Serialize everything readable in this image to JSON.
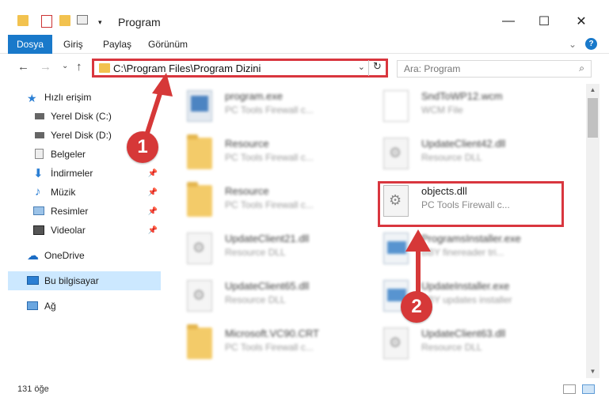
{
  "window": {
    "title": "Program",
    "minimize": "—",
    "maximize": "☐",
    "close": "✕"
  },
  "ribbon": {
    "tabs": [
      "Dosya",
      "Giriş",
      "Paylaş",
      "Görünüm"
    ],
    "expand_icon": "⌄",
    "help_icon": "?"
  },
  "nav": {
    "back": "←",
    "forward": "→",
    "recent": "⌄",
    "up": "↑"
  },
  "address": {
    "path": "C:\\Program Files\\Program Dizini",
    "dropdown": "⌄",
    "refresh": "↻"
  },
  "search": {
    "placeholder": "Ara: Program",
    "icon": "⌕"
  },
  "sidebar": {
    "items": [
      {
        "label": "Hızlı erişim",
        "icon": "star-icon"
      },
      {
        "label": "Yerel Disk (C:)",
        "icon": "drive-icon",
        "pin": true
      },
      {
        "label": "Yerel Disk (D:)",
        "icon": "drive-icon",
        "pin": true
      },
      {
        "label": "Belgeler",
        "icon": "documents-icon",
        "pin": true
      },
      {
        "label": "İndirmeler",
        "icon": "download-icon",
        "pin": true
      },
      {
        "label": "Müzik",
        "icon": "music-icon",
        "pin": true
      },
      {
        "label": "Resimler",
        "icon": "pictures-icon",
        "pin": true
      },
      {
        "label": "Videolar",
        "icon": "videos-icon",
        "pin": true
      },
      {
        "label": "OneDrive",
        "icon": "cloud-icon"
      },
      {
        "label": "Bu bilgisayar",
        "icon": "computer-icon",
        "selected": true
      },
      {
        "label": "Ağ",
        "icon": "network-icon"
      }
    ]
  },
  "files": [
    {
      "name": "program.exe",
      "type": "PC Tools Firewall c...",
      "icon": "exe"
    },
    {
      "name": "SndToWP12.wcm",
      "type": "WCM File",
      "icon": "doc"
    },
    {
      "name": "Resource",
      "type": "PC Tools Firewall c...",
      "icon": "folder"
    },
    {
      "name": "UpdateClient42.dll",
      "type": "Resource DLL",
      "icon": "gear"
    },
    {
      "name": "Resource",
      "type": "PC Tools Firewall c...",
      "icon": "folder"
    },
    {
      "name": "objects.dll",
      "type": "PC Tools Firewall c...",
      "icon": "gear",
      "highlighted": true
    },
    {
      "name": "UpdateClient21.dll",
      "type": "Resource DLL",
      "icon": "gear"
    },
    {
      "name": "ProgramsInstaller.exe",
      "type": "BBY finereader tri...",
      "icon": "installer"
    },
    {
      "name": "UpdateClient65.dll",
      "type": "Resource DLL",
      "icon": "gear"
    },
    {
      "name": "UpdateInstaller.exe",
      "type": "BBY updates installer",
      "icon": "installer"
    },
    {
      "name": "Microsoft.VC90.CRT",
      "type": "PC Tools Firewall c...",
      "icon": "folder"
    },
    {
      "name": "UpdateClient63.dll",
      "type": "Resource DLL",
      "icon": "gear"
    }
  ],
  "status": {
    "count": "131 öğe"
  },
  "markers": {
    "one": "1",
    "two": "2"
  },
  "colors": {
    "accent": "#1979ca",
    "highlight": "#d9363e",
    "selected": "#cce8ff"
  }
}
